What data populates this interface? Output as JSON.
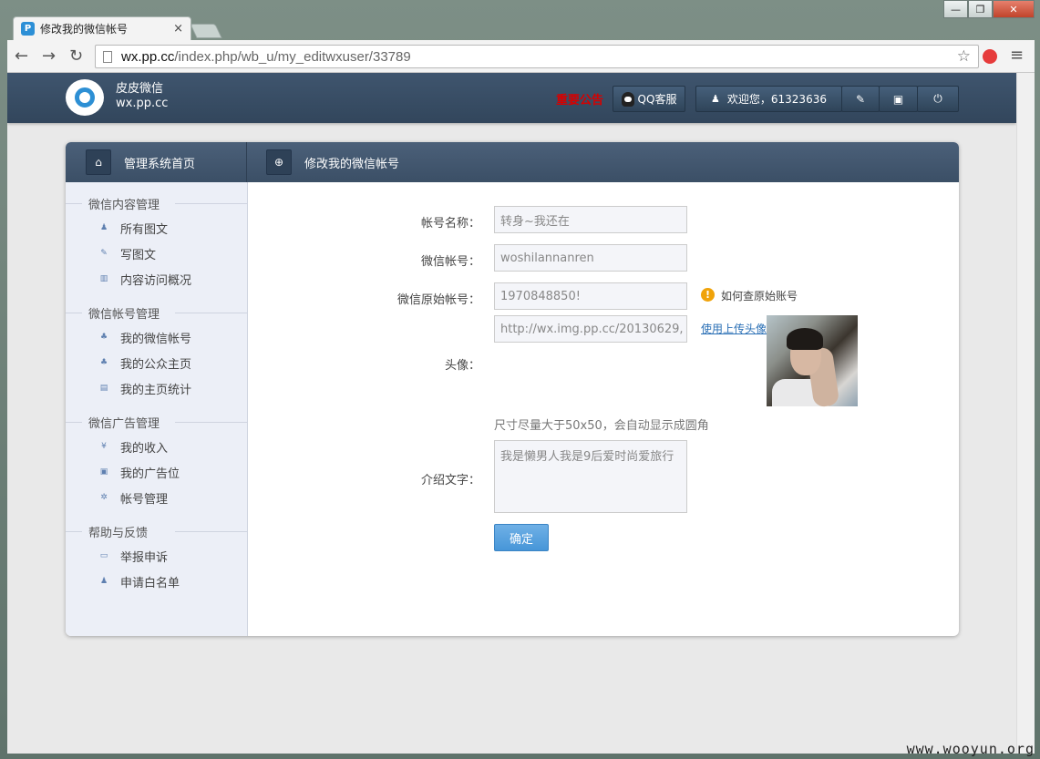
{
  "browser": {
    "tab_title": "修改我的微信帐号",
    "tab_favicon": "P",
    "tab_close": "×",
    "window_min": "—",
    "window_max": "❐",
    "window_close": "✕",
    "back_icon": "←",
    "forward_icon": "→",
    "reload_icon": "↻",
    "url_host": "wx.pp.cc",
    "url_path": "/index.php/wb_u/my_editwxuser/33789",
    "star_icon": "☆",
    "menu_icon": "≡"
  },
  "topbar": {
    "logo_name": "皮皮微信",
    "logo_domain": "wx.pp.cc",
    "notice": "重要公告",
    "qq_service": "QQ客服",
    "welcome": "欢迎您，61323636",
    "user_icon": "♟",
    "icons": [
      "✎",
      "▣",
      "⏻"
    ]
  },
  "panel": {
    "home_title": "管理系统首页",
    "home_icon": "⌂",
    "page_title": "修改我的微信帐号",
    "page_icon": "⊕"
  },
  "sidebar": {
    "groups": [
      {
        "title": "微信内容管理",
        "items": [
          {
            "label": "所有图文",
            "icon": "♟"
          },
          {
            "label": "写图文",
            "icon": "✎"
          },
          {
            "label": "内容访问概况",
            "icon": "▥"
          }
        ]
      },
      {
        "title": "微信帐号管理",
        "items": [
          {
            "label": "我的微信帐号",
            "icon": "♣"
          },
          {
            "label": "我的公众主页",
            "icon": "♣"
          },
          {
            "label": "我的主页统计",
            "icon": "▤"
          }
        ]
      },
      {
        "title": "微信广告管理",
        "items": [
          {
            "label": "我的收入",
            "icon": "¥"
          },
          {
            "label": "我的广告位",
            "icon": "▣"
          },
          {
            "label": "帐号管理",
            "icon": "✲"
          }
        ]
      },
      {
        "title": "帮助与反馈",
        "items": [
          {
            "label": "举报申诉",
            "icon": "▭"
          },
          {
            "label": "申请白名单",
            "icon": "♟"
          }
        ]
      }
    ]
  },
  "form": {
    "account_name_label": "帐号名称：",
    "account_name_value": "转身~我还在",
    "wechat_id_label": "微信帐号：",
    "wechat_id_value": "woshilannanren",
    "original_id_label": "微信原始帐号：",
    "original_id_value": "1970848850!",
    "original_hint": "如何查原始账号",
    "avatar_label": "头像：",
    "avatar_url": "http://wx.img.pp.cc/20130629,",
    "upload_link": "使用上传头像",
    "size_hint": "尺寸尽量大于50x50，会自动显示成圆角",
    "intro_label": "介绍文字：",
    "intro_value": "我是懒男人我是9后爱时尚爱旅行",
    "submit": "确定"
  },
  "watermark": "www.wooyun.org"
}
